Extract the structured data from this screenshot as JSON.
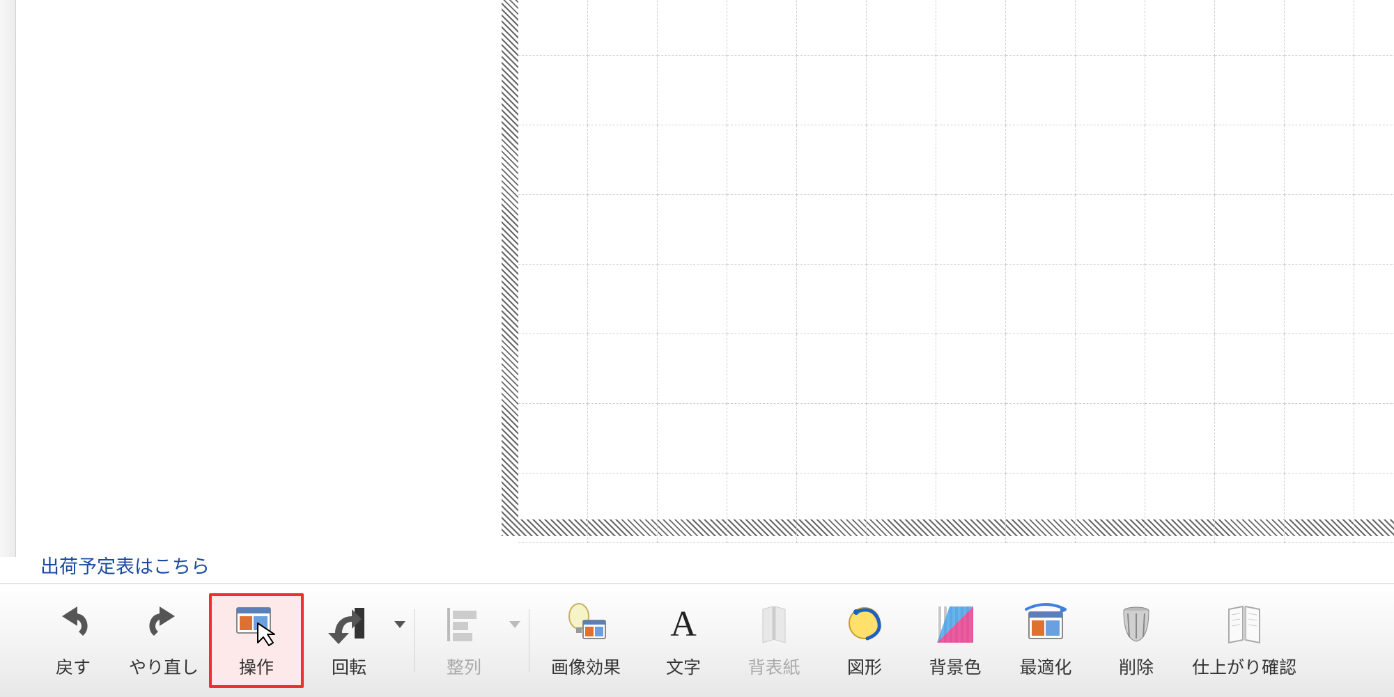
{
  "link_text": "出荷予定表はこちら",
  "toolbar": {
    "undo": "戻す",
    "redo": "やり直し",
    "operate": "操作",
    "rotate": "回転",
    "align": "整列",
    "image_effect": "画像効果",
    "text": "文字",
    "spine": "背表紙",
    "shape": "図形",
    "bgcolor": "背景色",
    "optimize": "最適化",
    "delete": "削除",
    "preview": "仕上がり確認"
  }
}
